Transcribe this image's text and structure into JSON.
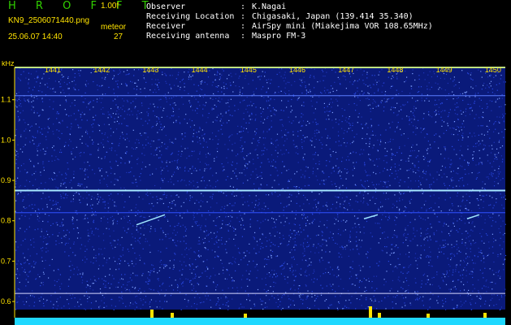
{
  "header": {
    "brand": "H R O F F T",
    "version": "1.00f",
    "filename": "KN9_2506071440.png",
    "mode": "meteor",
    "datetime": "25.06.07 14:40",
    "count": "27",
    "fields": [
      {
        "label": "Observer",
        "value": "K.Nagai"
      },
      {
        "label": "Receiving Location",
        "value": "Chigasaki, Japan (139.414 35.340)"
      },
      {
        "label": "Receiver",
        "value": "AirSpy mini (Miakejima VOR 108.65MHz)"
      },
      {
        "label": "Receiving antenna",
        "value": "Maspro FM-3"
      }
    ]
  },
  "chart_data": {
    "type": "heatmap",
    "ylabel": "kHz",
    "y_ticks": [
      "1.1",
      "1.0",
      "0.9",
      "0.8",
      "0.7",
      "0.6"
    ],
    "x_ticks": [
      "1441",
      "1442",
      "1443",
      "1444",
      "1445",
      "1446",
      "1447",
      "1448",
      "1449",
      "1450"
    ],
    "y_range_khz": [
      0.58,
      1.18
    ],
    "colors": {
      "background": "#0a1a7a",
      "noise": "#3a5aff",
      "signal": "#9fe6ff",
      "hist": "#1fd8ff",
      "tick": "#ffe300"
    }
  }
}
